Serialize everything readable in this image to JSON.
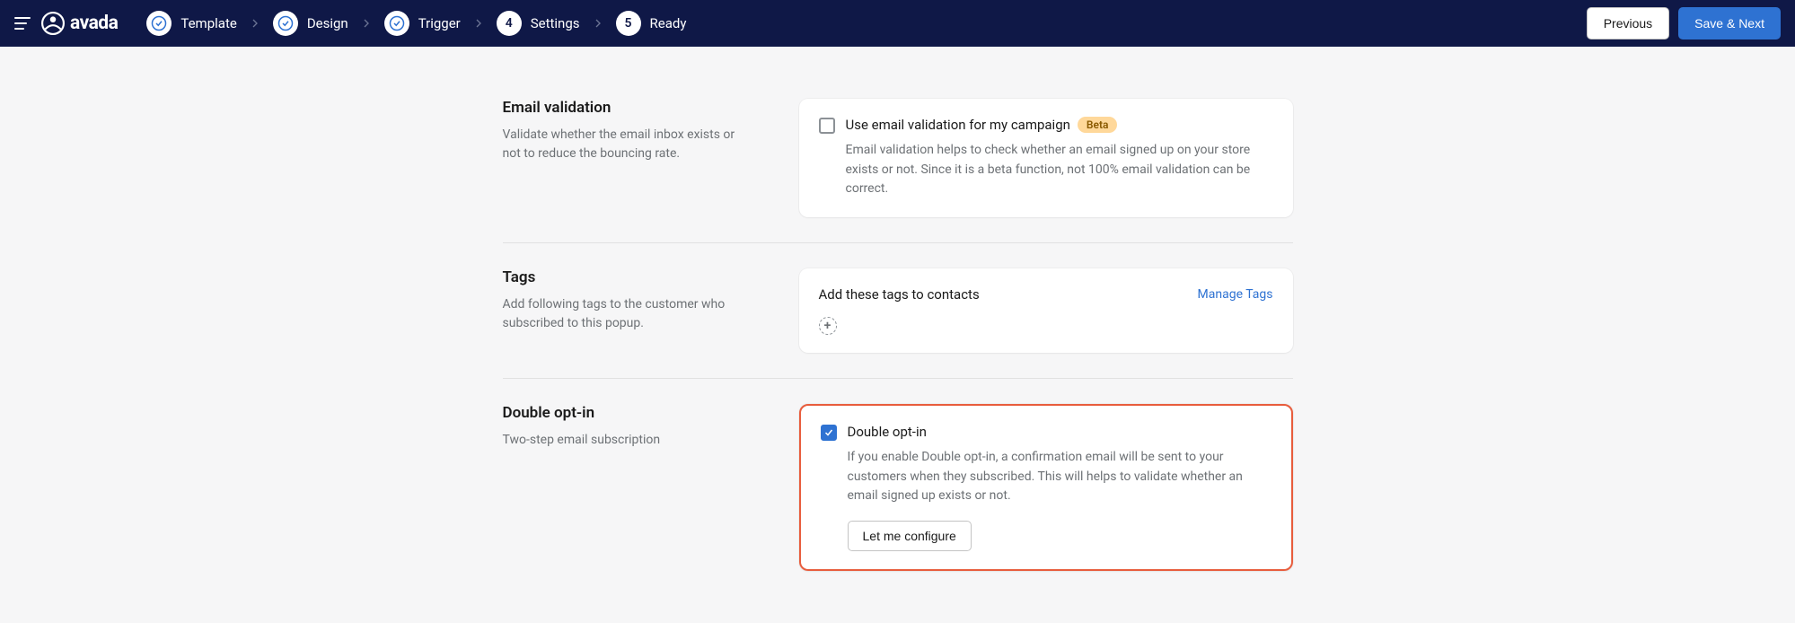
{
  "logo": "avada",
  "steps": [
    {
      "label": "Template",
      "done": true
    },
    {
      "label": "Design",
      "done": true
    },
    {
      "label": "Trigger",
      "done": true
    },
    {
      "label": "Settings",
      "num": "4"
    },
    {
      "label": "Ready",
      "num": "5"
    }
  ],
  "buttons": {
    "prev": "Previous",
    "next": "Save & Next"
  },
  "sections": {
    "validation": {
      "title": "Email validation",
      "desc": "Validate whether the email inbox exists or not to reduce the bouncing rate.",
      "check_label": "Use email validation for my campaign",
      "badge": "Beta",
      "card_desc": "Email validation helps to check whether an email signed up on your store exists or not. Since it is a beta function, not 100% email validation can be correct."
    },
    "tags": {
      "title": "Tags",
      "desc": "Add following tags to the customer who subscribed to this popup.",
      "card_title": "Add these tags to contacts",
      "manage": "Manage Tags"
    },
    "optin": {
      "title": "Double opt-in",
      "desc": "Two-step email subscription",
      "check_label": "Double opt-in",
      "card_desc": "If you enable Double opt-in, a confirmation email will be sent to your customers when they subscribed. This will helps to validate whether an email signed up exists or not.",
      "configure": "Let me configure"
    }
  }
}
